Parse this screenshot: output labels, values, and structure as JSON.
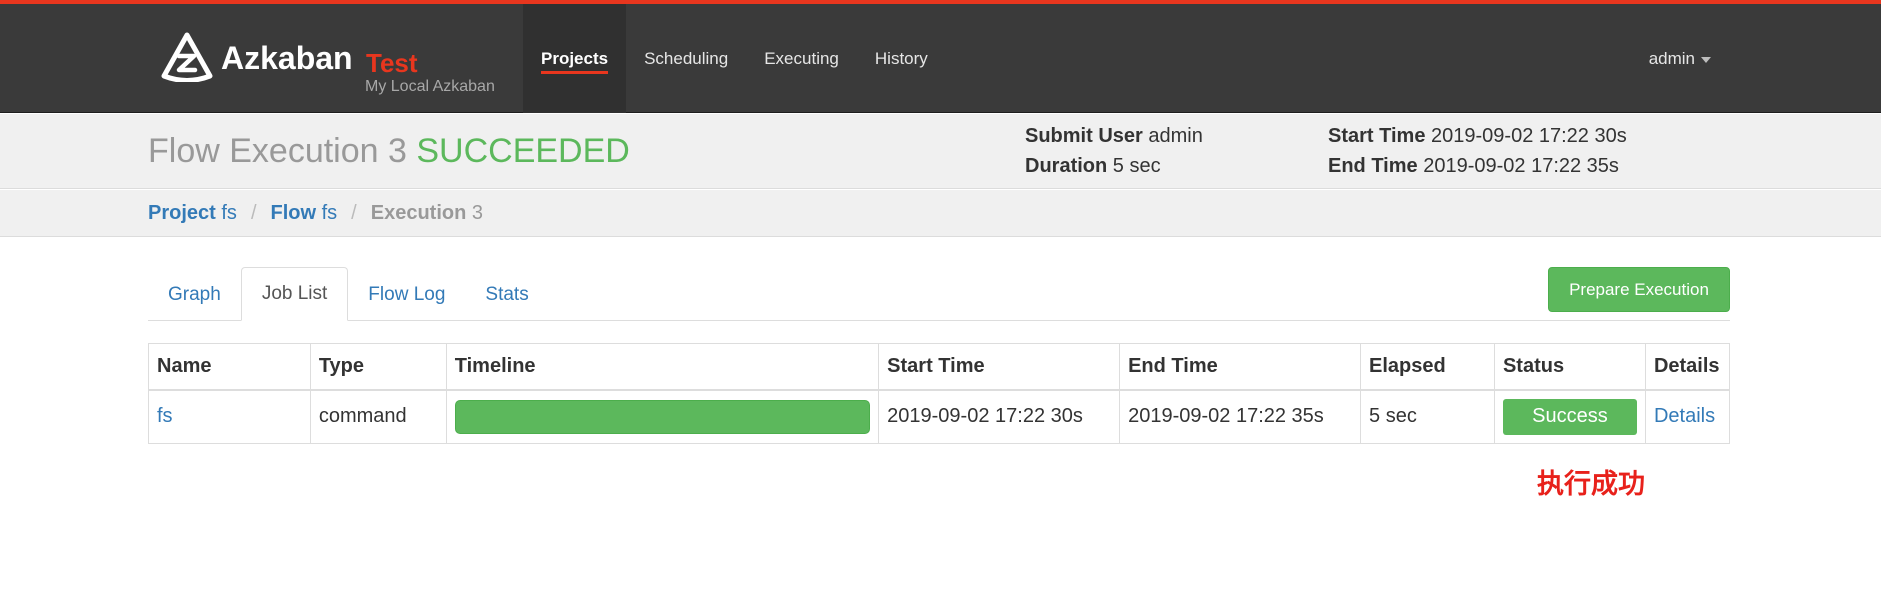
{
  "brand": {
    "name": "Azkaban",
    "env": "Test",
    "subtitle": "My Local Azkaban",
    "logo_icon": "azkaban-logo-icon"
  },
  "nav": {
    "items": [
      {
        "label": "Projects",
        "active": true
      },
      {
        "label": "Scheduling",
        "active": false
      },
      {
        "label": "Executing",
        "active": false
      },
      {
        "label": "History",
        "active": false
      }
    ],
    "user": "admin",
    "user_caret_icon": "caret-down-icon"
  },
  "execution": {
    "title": "Flow Execution 3",
    "status": "SUCCEEDED",
    "submit_user_label": "Submit User",
    "submit_user": "admin",
    "duration_label": "Duration",
    "duration": "5 sec",
    "start_time_label": "Start Time",
    "start_time": "2019-09-02 17:22 30s",
    "end_time_label": "End Time",
    "end_time": "2019-09-02 17:22 35s"
  },
  "breadcrumb": {
    "project_label": "Project",
    "project": "fs",
    "flow_label": "Flow",
    "flow": "fs",
    "execution_label": "Execution",
    "execution": "3",
    "separator": "/"
  },
  "tabs": [
    {
      "label": "Graph",
      "active": false
    },
    {
      "label": "Job List",
      "active": true
    },
    {
      "label": "Flow Log",
      "active": false
    },
    {
      "label": "Stats",
      "active": false
    }
  ],
  "prepare_button": "Prepare Execution",
  "jobs_table": {
    "headers": [
      "Name",
      "Type",
      "Timeline",
      "Start Time",
      "End Time",
      "Elapsed",
      "Status",
      "Details"
    ],
    "rows": [
      {
        "name": "fs",
        "type": "command",
        "timeline_progress": 1.0,
        "start_time": "2019-09-02 17:22 30s",
        "end_time": "2019-09-02 17:22 35s",
        "elapsed": "5 sec",
        "status": "Success",
        "details": "Details"
      }
    ]
  },
  "annotation": "执行成功",
  "colors": {
    "accent": "#e8361e",
    "navbar": "#3a3a3a",
    "success": "#5cb85c",
    "link": "#337ab7",
    "annotation": "#e8211b"
  }
}
